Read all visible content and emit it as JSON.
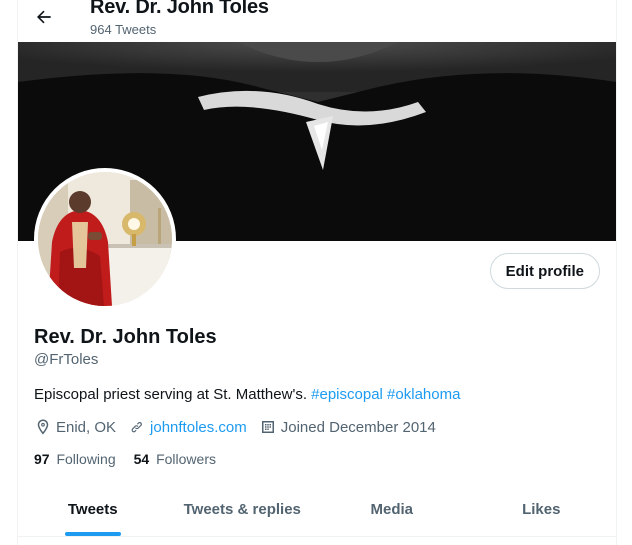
{
  "header": {
    "title": "Rev. Dr. John Toles",
    "tweet_count": "964 Tweets"
  },
  "profile": {
    "name": "Rev. Dr. John Toles",
    "handle": "@FrToles",
    "bio_text": "Episcopal priest serving at St. Matthew's.",
    "hashtags": [
      "#episcopal",
      "#oklahoma"
    ],
    "location": "Enid, OK",
    "website": "johnftoles.com",
    "joined": "Joined December 2014",
    "following_count": "97",
    "following_label": "Following",
    "followers_count": "54",
    "followers_label": "Followers",
    "edit_button": "Edit profile"
  },
  "tabs": [
    {
      "label": "Tweets",
      "active": true
    },
    {
      "label": "Tweets & replies",
      "active": false
    },
    {
      "label": "Media",
      "active": false
    },
    {
      "label": "Likes",
      "active": false
    }
  ],
  "colors": {
    "accent": "#1d9bf0",
    "text_primary": "#0f1419",
    "text_secondary": "#536471",
    "border": "#cfd9de"
  },
  "icons": {
    "back": "arrow-left-icon",
    "location": "location-pin-icon",
    "website": "link-icon",
    "joined": "calendar-icon"
  }
}
